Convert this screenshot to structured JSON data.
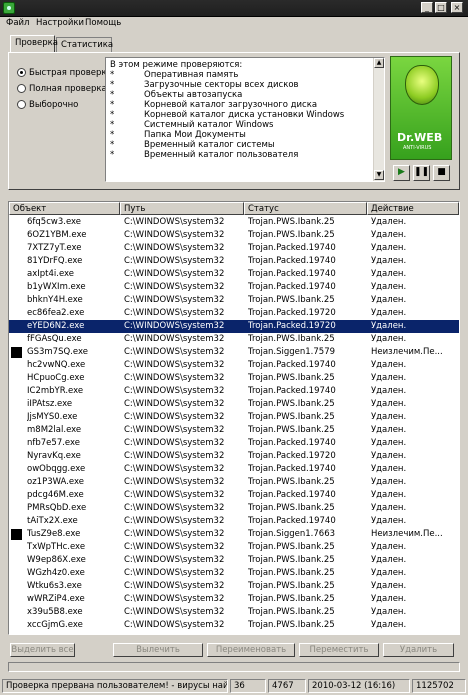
{
  "window": {
    "menu": [
      "Файл",
      "Настройки",
      "Помощь"
    ]
  },
  "tabs": [
    "Проверка",
    "Статистика"
  ],
  "scan_modes": {
    "items": [
      "Быстрая проверка",
      "Полная проверка",
      "Выборочно"
    ],
    "selected": "Быстрая проверка"
  },
  "info": {
    "heading": "В этом режиме проверяются:",
    "bullet": "*",
    "items": [
      "Оперативная память",
      "Загрузочные секторы всех дисков",
      "Объекты автозапуска",
      "Корневой каталог загрузочного диска",
      "Корневой каталог диска установки Windows",
      "Системный каталог Windows",
      "Папка Мои Документы",
      "Временный каталог системы",
      "Временный каталог пользователя"
    ]
  },
  "logo": {
    "brand": "Dr.WEB",
    "sub": "ANTI-VIRUS"
  },
  "table": {
    "headers": [
      "Объект",
      "Путь",
      "Статус",
      "Действие"
    ],
    "rows": [
      {
        "obj": "6fq5cw3.exe",
        "path": "C:\\WINDOWS\\system32",
        "status": "Trojan.PWS.Ibank.25",
        "action": "Удален.",
        "mark": false
      },
      {
        "obj": "6OZ1YBM.exe",
        "path": "C:\\WINDOWS\\system32",
        "status": "Trojan.PWS.Ibank.25",
        "action": "Удален.",
        "mark": false
      },
      {
        "obj": "7XTZ7yT.exe",
        "path": "C:\\WINDOWS\\system32",
        "status": "Trojan.Packed.19740",
        "action": "Удален.",
        "mark": false
      },
      {
        "obj": "81YDrFQ.exe",
        "path": "C:\\WINDOWS\\system32",
        "status": "Trojan.Packed.19740",
        "action": "Удален.",
        "mark": false
      },
      {
        "obj": "axIpt4i.exe",
        "path": "C:\\WINDOWS\\system32",
        "status": "Trojan.Packed.19740",
        "action": "Удален.",
        "mark": false
      },
      {
        "obj": "b1yWXIm.exe",
        "path": "C:\\WINDOWS\\system32",
        "status": "Trojan.Packed.19740",
        "action": "Удален.",
        "mark": false
      },
      {
        "obj": "bhknY4H.exe",
        "path": "C:\\WINDOWS\\system32",
        "status": "Trojan.PWS.Ibank.25",
        "action": "Удален.",
        "mark": false
      },
      {
        "obj": "ec86fea2.exe",
        "path": "C:\\WINDOWS\\system32",
        "status": "Trojan.Packed.19720",
        "action": "Удален.",
        "mark": false
      },
      {
        "obj": "eYED6N2.exe",
        "path": "C:\\WINDOWS\\system32",
        "status": "Trojan.Packed.19720",
        "action": "Удален.",
        "mark": false,
        "selected": true
      },
      {
        "obj": "fFGAsQu.exe",
        "path": "C:\\WINDOWS\\system32",
        "status": "Trojan.PWS.Ibank.25",
        "action": "Удален.",
        "mark": false
      },
      {
        "obj": "GS3m7SQ.exe",
        "path": "C:\\WINDOWS\\system32",
        "status": "Trojan.Siggen1.7579",
        "action": "Неизлечим.Пе...",
        "mark": true
      },
      {
        "obj": "hc2vwNQ.exe",
        "path": "C:\\WINDOWS\\system32",
        "status": "Trojan.Packed.19740",
        "action": "Удален.",
        "mark": false
      },
      {
        "obj": "HCpuoCg.exe",
        "path": "C:\\WINDOWS\\system32",
        "status": "Trojan.PWS.Ibank.25",
        "action": "Удален.",
        "mark": false
      },
      {
        "obj": "IC2mbYR.exe",
        "path": "C:\\WINDOWS\\system32",
        "status": "Trojan.Packed.19740",
        "action": "Удален.",
        "mark": false
      },
      {
        "obj": "iIPAtsz.exe",
        "path": "C:\\WINDOWS\\system32",
        "status": "Trojan.PWS.Ibank.25",
        "action": "Удален.",
        "mark": false
      },
      {
        "obj": "JjsMYS0.exe",
        "path": "C:\\WINDOWS\\system32",
        "status": "Trojan.PWS.Ibank.25",
        "action": "Удален.",
        "mark": false
      },
      {
        "obj": "m8M2lal.exe",
        "path": "C:\\WINDOWS\\system32",
        "status": "Trojan.PWS.Ibank.25",
        "action": "Удален.",
        "mark": false
      },
      {
        "obj": "nfb7e57.exe",
        "path": "C:\\WINDOWS\\system32",
        "status": "Trojan.Packed.19740",
        "action": "Удален.",
        "mark": false
      },
      {
        "obj": "NyravKq.exe",
        "path": "C:\\WINDOWS\\system32",
        "status": "Trojan.Packed.19720",
        "action": "Удален.",
        "mark": false
      },
      {
        "obj": "owObqgg.exe",
        "path": "C:\\WINDOWS\\system32",
        "status": "Trojan.Packed.19740",
        "action": "Удален.",
        "mark": false
      },
      {
        "obj": "oz1P3WA.exe",
        "path": "C:\\WINDOWS\\system32",
        "status": "Trojan.PWS.Ibank.25",
        "action": "Удален.",
        "mark": false
      },
      {
        "obj": "pdcg46M.exe",
        "path": "C:\\WINDOWS\\system32",
        "status": "Trojan.Packed.19740",
        "action": "Удален.",
        "mark": false
      },
      {
        "obj": "PMRsQbD.exe",
        "path": "C:\\WINDOWS\\system32",
        "status": "Trojan.PWS.Ibank.25",
        "action": "Удален.",
        "mark": false
      },
      {
        "obj": "tAiTx2X.exe",
        "path": "C:\\WINDOWS\\system32",
        "status": "Trojan.Packed.19740",
        "action": "Удален.",
        "mark": false
      },
      {
        "obj": "TusZ9e8.exe",
        "path": "C:\\WINDOWS\\system32",
        "status": "Trojan.Siggen1.7663",
        "action": "Неизлечим.Пе...",
        "mark": true
      },
      {
        "obj": "TxWpTHc.exe",
        "path": "C:\\WINDOWS\\system32",
        "status": "Trojan.PWS.Ibank.25",
        "action": "Удален.",
        "mark": false
      },
      {
        "obj": "W9ep86X.exe",
        "path": "C:\\WINDOWS\\system32",
        "status": "Trojan.PWS.Ibank.25",
        "action": "Удален.",
        "mark": false
      },
      {
        "obj": "WGzh4z0.exe",
        "path": "C:\\WINDOWS\\system32",
        "status": "Trojan.PWS.Ibank.25",
        "action": "Удален.",
        "mark": false
      },
      {
        "obj": "Wtku6s3.exe",
        "path": "C:\\WINDOWS\\system32",
        "status": "Trojan.PWS.Ibank.25",
        "action": "Удален.",
        "mark": false
      },
      {
        "obj": "wWRZiP4.exe",
        "path": "C:\\WINDOWS\\system32",
        "status": "Trojan.PWS.Ibank.25",
        "action": "Удален.",
        "mark": false
      },
      {
        "obj": "x39u5B8.exe",
        "path": "C:\\WINDOWS\\system32",
        "status": "Trojan.PWS.Ibank.25",
        "action": "Удален.",
        "mark": false
      },
      {
        "obj": "xccGjmG.exe",
        "path": "C:\\WINDOWS\\system32",
        "status": "Trojan.PWS.Ibank.25",
        "action": "Удален.",
        "mark": false
      }
    ]
  },
  "buttons": [
    "Выделить все",
    "Вылечить",
    "Переименовать",
    "Переместить",
    "Удалить"
  ],
  "status": {
    "message": "Проверка прервана пользователем! - вирусы найдены",
    "found": "36",
    "scanned": "4767",
    "datetime": "2010-03-12 (16:16)",
    "size": "1125702"
  }
}
